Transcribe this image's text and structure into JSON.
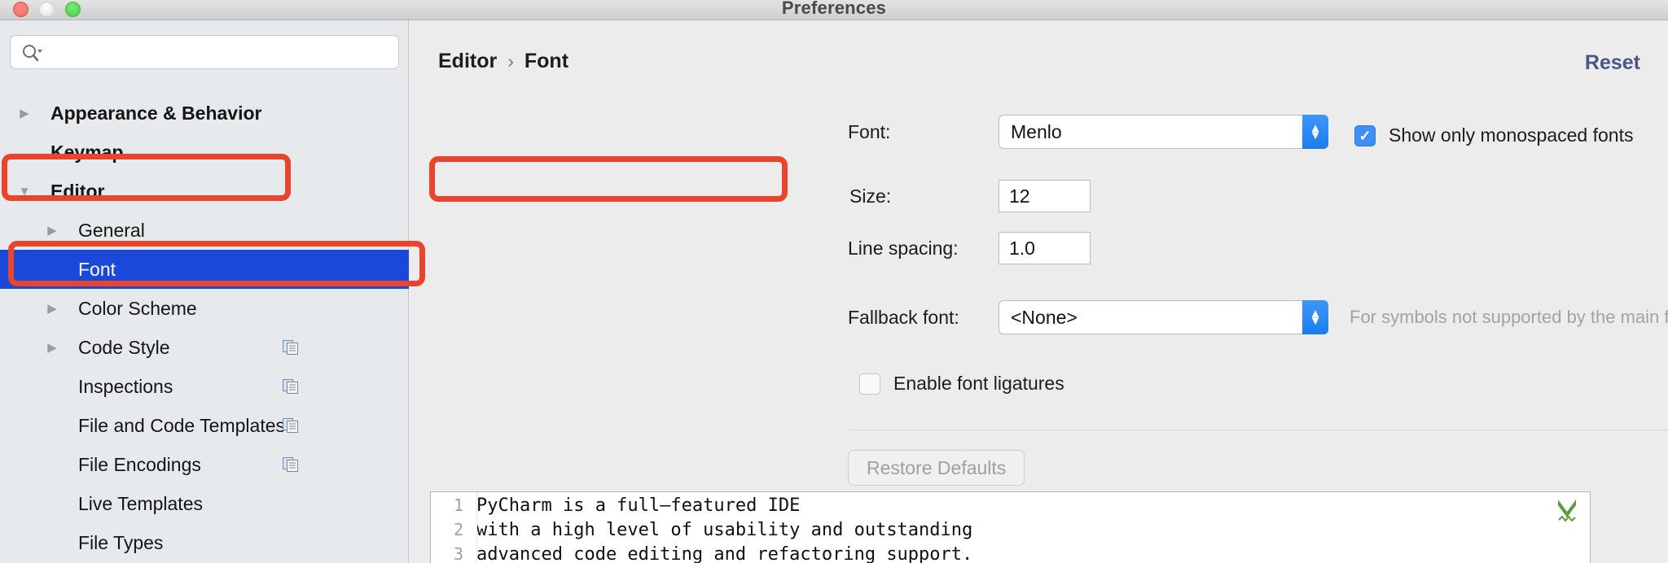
{
  "window": {
    "title": "Preferences",
    "traffic_lights": [
      "close-button",
      "minimize-button",
      "maximize-button"
    ]
  },
  "sidebar": {
    "search": {
      "value": "",
      "placeholder": "",
      "icon": "search-icon"
    },
    "items": [
      {
        "label": "Appearance & Behavior",
        "level": "top",
        "twisty": "collapsed",
        "bold": true,
        "selected": false,
        "copy_icon": false
      },
      {
        "label": "Keymap",
        "level": "top",
        "twisty": "none",
        "bold": true,
        "selected": false,
        "copy_icon": false
      },
      {
        "label": "Editor",
        "level": "top",
        "twisty": "expanded",
        "bold": true,
        "selected": false,
        "copy_icon": false
      },
      {
        "label": "General",
        "level": "child",
        "twisty": "collapsed",
        "bold": false,
        "selected": false,
        "copy_icon": false
      },
      {
        "label": "Font",
        "level": "child",
        "twisty": "none",
        "bold": false,
        "selected": true,
        "copy_icon": false
      },
      {
        "label": "Color Scheme",
        "level": "child",
        "twisty": "collapsed",
        "bold": false,
        "selected": false,
        "copy_icon": false
      },
      {
        "label": "Code Style",
        "level": "child",
        "twisty": "collapsed",
        "bold": false,
        "selected": false,
        "copy_icon": true
      },
      {
        "label": "Inspections",
        "level": "child",
        "twisty": "none",
        "bold": false,
        "selected": false,
        "copy_icon": true
      },
      {
        "label": "File and Code Templates",
        "level": "child",
        "twisty": "none",
        "bold": false,
        "selected": false,
        "copy_icon": true
      },
      {
        "label": "File Encodings",
        "level": "child",
        "twisty": "none",
        "bold": false,
        "selected": false,
        "copy_icon": true
      },
      {
        "label": "Live Templates",
        "level": "child",
        "twisty": "none",
        "bold": false,
        "selected": false,
        "copy_icon": false
      },
      {
        "label": "File Types",
        "level": "child",
        "twisty": "none",
        "bold": false,
        "selected": false,
        "copy_icon": false
      }
    ]
  },
  "main": {
    "breadcrumb": {
      "parent": "Editor",
      "separator": "›",
      "current": "Font"
    },
    "reset_label": "Reset",
    "font_row": {
      "label": "Font:",
      "value": "Menlo"
    },
    "size_row": {
      "label": "Size:",
      "value": "12"
    },
    "line_spacing_row": {
      "label": "Line spacing:",
      "value": "1.0"
    },
    "fallback_row": {
      "label": "Fallback font:",
      "value": "<None>",
      "hint": "For symbols not supported by the main font"
    },
    "monospaced_checkbox": {
      "label": "Show only monospaced fonts",
      "checked": true
    },
    "ligatures_checkbox": {
      "label": "Enable font ligatures",
      "checked": false
    },
    "restore_defaults_label": "Restore Defaults"
  },
  "preview": {
    "lines": [
      {
        "number": "1",
        "text": "PyCharm is a full—featured IDE"
      },
      {
        "number": "2",
        "text": "with a high level of usability and outstanding"
      },
      {
        "number": "3",
        "text": "advanced code editing and refactoring support."
      }
    ],
    "inspection_icon": "green-check-inspection-icon"
  },
  "annotations": {
    "accent_color": "#e8452c",
    "boxes": [
      {
        "name": "editor-highlight"
      },
      {
        "name": "font-highlight"
      },
      {
        "name": "size-highlight"
      }
    ]
  },
  "colors": {
    "selection_blue": "#1a48d8",
    "accent_blue": "#3d8ef5",
    "reset_link": "#4b5588",
    "annotation_red": "#e8452c"
  }
}
